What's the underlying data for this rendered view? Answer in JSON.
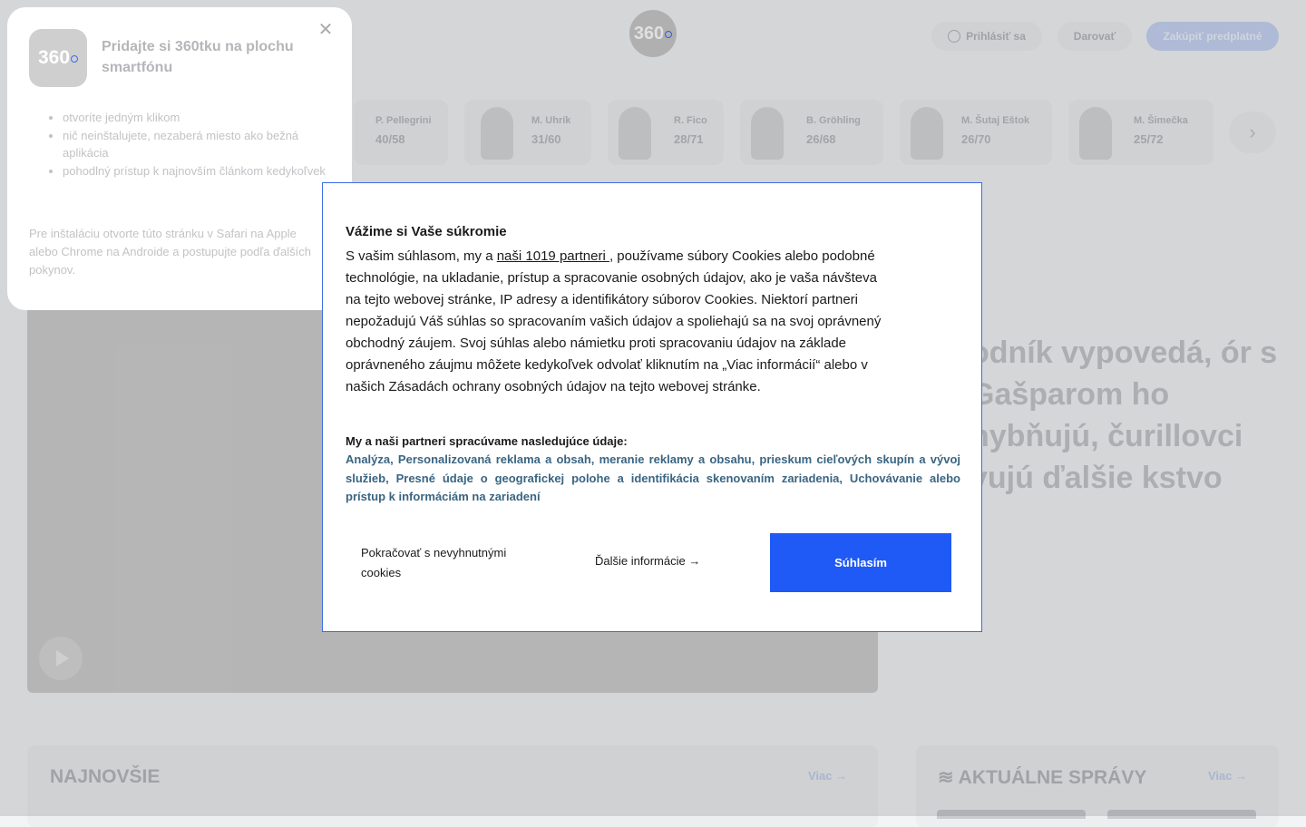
{
  "header": {
    "logo_text": "360",
    "login_label": "Prihlásiť sa",
    "donate_label": "Darovať",
    "subscribe_label": "Zakúpiť predplatné"
  },
  "politicians": [
    {
      "name": "P. Pellegrini",
      "score": "40/58"
    },
    {
      "name": "M. Uhrík",
      "score": "31/60"
    },
    {
      "name": "R. Fico",
      "score": "28/71"
    },
    {
      "name": "B. Gröhling",
      "score": "26/68"
    },
    {
      "name": "M. Šutaj Eštok",
      "score": "26/70"
    },
    {
      "name": "M. Šimečka",
      "score": "25/72"
    }
  ],
  "hero": {
    "headline": "odník vypovedá, ór s Gašparom ho hybňujú, čurillovci vujú ďalšie kstvo"
  },
  "sections": {
    "latest_title": "NAJNOVŠIE",
    "latest_more": "Viac",
    "news_title": "AKTUÁLNE SPRÁVY",
    "news_more": "Viac"
  },
  "app_prompt": {
    "logo_text": "360",
    "title": "Pridajte si 360tku na plochu smartfónu",
    "bullets": [
      "otvoríte jedným klikom",
      "nič neinštalujete, nezaberá miesto ako bežná aplikácia",
      "pohodlný prístup k najnovším článkom kedykoľvek"
    ],
    "note": "Pre inštaláciu otvorte túto stránku v Safari na Apple alebo Chrome na Androide a postupujte podľa ďalších pokynov."
  },
  "cookie": {
    "title": "Vážime si Vaše súkromie",
    "body_pre": "S vašim súhlasom, my a ",
    "partners_link": "naši 1019 partneri ",
    "body_post": ", používame súbory Cookies alebo podobné technológie, na ukladanie, prístup a spracovanie osobných údajov, ako je vaša návšteva na tejto webovej stránke, IP adresy a identifikátory súborov Cookies. Niektorí partneri nepožadujú Váš súhlas so spracovaním vašich údajov a spoliehajú sa na svoj oprávnený obchodný záujem. Svoj súhlas alebo námietku proti spracovaniu údajov na základe oprávneného záujmu môžete kedykoľvek odvolať kliknutím na „Viac informácií“ alebo v našich Zásadách ochrany osobných údajov na tejto webovej stránke.",
    "purposes_heading": "My a naši partneri spracúvame nasledujúce údaje:",
    "purposes": "Analýza, Personalizovaná reklama a obsah, meranie reklamy a obsahu, prieskum cieľových skupín a vývoj služieb, Presné údaje o geografickej polohe a identifikácia skenovaním zariadenia, Uchovávanie alebo prístup k informáciám na zariadení",
    "necessary_label": "Pokračovať s nevyhnutnými cookies",
    "more_label": "Ďalšie informácie →",
    "accept_label": "Súhlasím"
  }
}
